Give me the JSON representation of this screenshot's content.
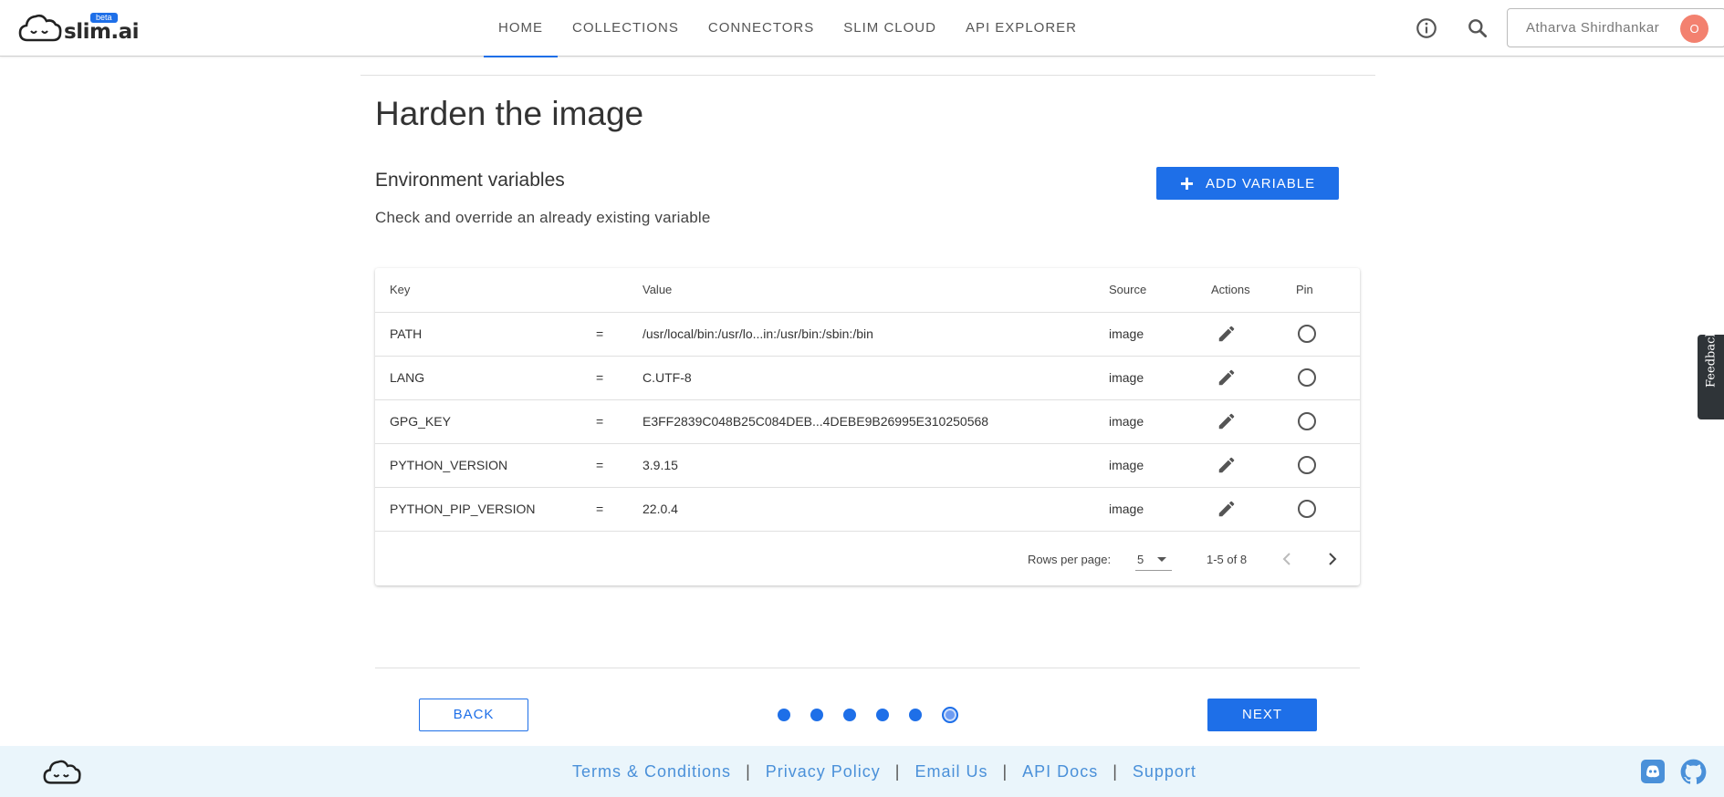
{
  "brand": {
    "name": "slim.ai",
    "badge": "beta"
  },
  "nav": {
    "items": [
      "HOME",
      "COLLECTIONS",
      "CONNECTORS",
      "SLIM CLOUD",
      "API EXPLORER"
    ],
    "active": "HOME"
  },
  "user": {
    "name": "Atharva Shirdhankar",
    "avatar_initial": "O"
  },
  "page": {
    "title": "Harden the image",
    "section_title": "Environment variables",
    "section_desc": "Check and override an already existing variable",
    "add_button_label": "ADD VARIABLE"
  },
  "table": {
    "headers": {
      "key": "Key",
      "value": "Value",
      "source": "Source",
      "actions": "Actions",
      "pin": "Pin"
    },
    "rows": [
      {
        "key": "PATH",
        "eq": "=",
        "value": "/usr/local/bin:/usr/lo...in:/usr/bin:/sbin:/bin",
        "source": "image"
      },
      {
        "key": "LANG",
        "eq": "=",
        "value": "C.UTF-8",
        "source": "image"
      },
      {
        "key": "GPG_KEY",
        "eq": "=",
        "value": "E3FF2839C048B25C084DEB...4DEBE9B26995E310250568",
        "source": "image"
      },
      {
        "key": "PYTHON_VERSION",
        "eq": "=",
        "value": "3.9.15",
        "source": "image"
      },
      {
        "key": "PYTHON_PIP_VERSION",
        "eq": "=",
        "value": "22.0.4",
        "source": "image"
      }
    ],
    "pagination": {
      "rows_per_page_label": "Rows per page:",
      "rows_per_page": "5",
      "range": "1-5 of 8"
    }
  },
  "wizard": {
    "back_label": "BACK",
    "next_label": "NEXT",
    "steps": 6,
    "current_step": 6
  },
  "feedback_label": "Feedback",
  "footer": {
    "links": [
      "Terms & Conditions",
      "Privacy Policy",
      "Email Us",
      "API Docs",
      "Support"
    ],
    "separator": "|"
  },
  "colors": {
    "accent": "#1e6fe8",
    "avatar": "#f3816f",
    "footer_bg": "#eaf5fb",
    "footer_link": "#4a90d9"
  },
  "icons": {
    "info": "info-icon",
    "search": "search-icon",
    "edit": "pencil-icon",
    "pin": "radio-circle-icon",
    "discord": "discord-icon",
    "github": "github-icon"
  }
}
